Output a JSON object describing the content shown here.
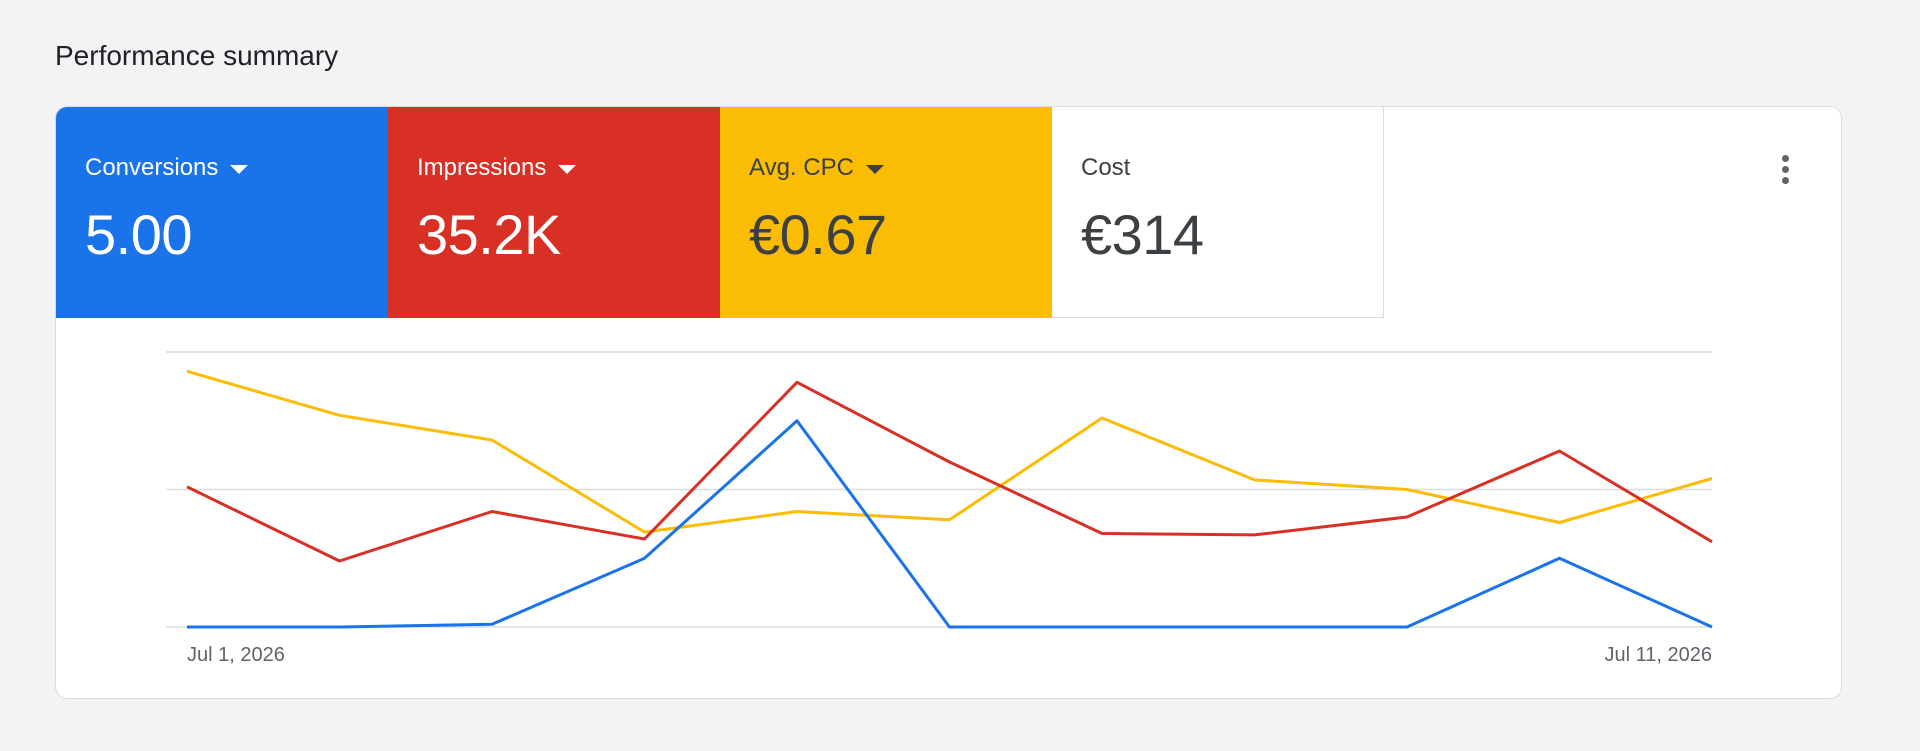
{
  "page": {
    "title": "Performance summary"
  },
  "tiles": [
    {
      "label": "Conversions",
      "value": "5.00",
      "color": "#1a73e8"
    },
    {
      "label": "Impressions",
      "value": "35.2K",
      "color": "#d93025"
    },
    {
      "label": "Avg. CPC",
      "value": "€0.67",
      "color": "#fbbc04"
    },
    {
      "label": "Cost",
      "value": "€314",
      "color": "#ffffff"
    }
  ],
  "menu": {
    "icon": "more-vert-icon"
  },
  "chart_data": {
    "type": "line",
    "x": [
      "2026-07-01",
      "2026-07-02",
      "2026-07-03",
      "2026-07-04",
      "2026-07-05",
      "2026-07-06",
      "2026-07-07",
      "2026-07-08",
      "2026-07-09",
      "2026-07-10",
      "2026-07-11"
    ],
    "x_tick_labels": [
      "Jul 1, 2026",
      "Jul 11, 2026"
    ],
    "grid": true,
    "gridlines": 3,
    "series": [
      {
        "name": "Conversions",
        "color": "#1a73e8",
        "values": [
          0,
          0,
          0.01,
          0.25,
          0.75,
          0,
          0,
          0,
          0,
          0.25,
          0
        ]
      },
      {
        "name": "Impressions",
        "color": "#d93025",
        "values": [
          0.51,
          0.24,
          0.42,
          0.32,
          0.89,
          0.6,
          0.34,
          0.335,
          0.4,
          0.64,
          0.31
        ]
      },
      {
        "name": "Avg. CPC",
        "color": "#fbbc04",
        "values": [
          0.93,
          0.77,
          0.68,
          0.345,
          0.42,
          0.39,
          0.76,
          0.535,
          0.5,
          0.38,
          0.54
        ]
      }
    ],
    "ylim": [
      0,
      1
    ]
  }
}
